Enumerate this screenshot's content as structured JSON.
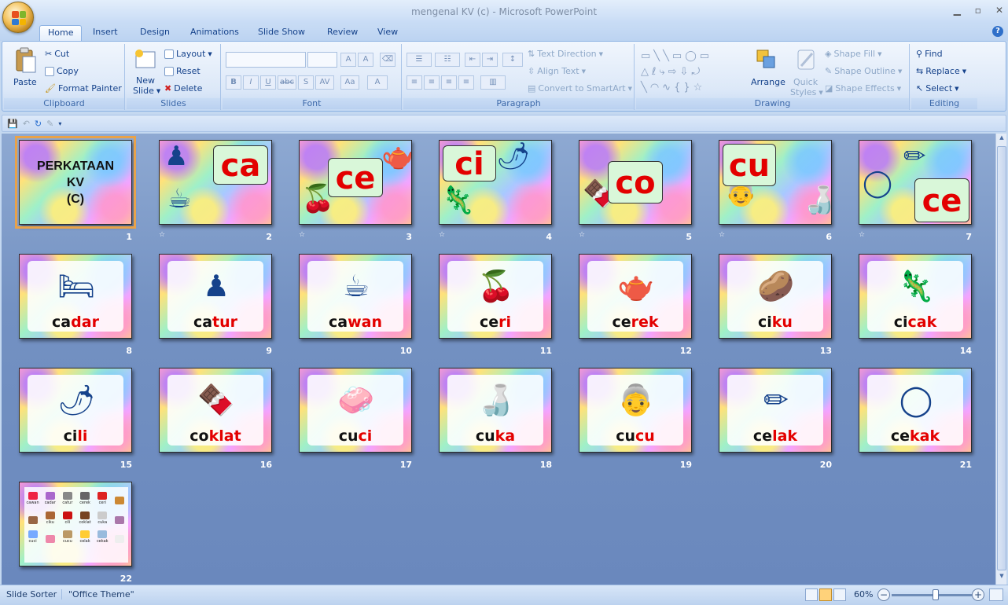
{
  "window": {
    "title": "mengenal KV (c)  -  Microsoft PowerPoint"
  },
  "ribbon_tabs": [
    "Home",
    "Insert",
    "Design",
    "Animations",
    "Slide Show",
    "Review",
    "View"
  ],
  "clipboard": {
    "paste": "Paste",
    "cut": "Cut",
    "copy": "Copy",
    "format_painter": "Format Painter",
    "label": "Clipboard"
  },
  "slides_group": {
    "new_slide": "New",
    "new_slide2": "Slide",
    "layout": "Layout",
    "reset": "Reset",
    "delete": "Delete",
    "label": "Slides"
  },
  "font_group": {
    "label": "Font",
    "bold": "B",
    "italic": "I",
    "underline": "U",
    "strike": "abc",
    "shadow": "S",
    "spacing": "AV",
    "case": "Aa",
    "color": "A"
  },
  "paragraph_group": {
    "label": "Paragraph",
    "text_direction": "Text Direction",
    "align_text": "Align Text",
    "convert_smartart": "Convert to SmartArt"
  },
  "drawing_group": {
    "label": "Drawing",
    "arrange": "Arrange",
    "quick_styles": "Quick",
    "quick_styles2": "Styles",
    "shape_fill": "Shape Fill",
    "shape_outline": "Shape Outline",
    "shape_effects": "Shape Effects"
  },
  "editing_group": {
    "label": "Editing",
    "find": "Find",
    "replace": "Replace",
    "select": "Select"
  },
  "title_slide": {
    "line1": "PERKATAAN",
    "line2": "KV",
    "line3": "(C)"
  },
  "syllable_slides": [
    {
      "num": "2",
      "syllable": "ca"
    },
    {
      "num": "3",
      "syllable": "ce"
    },
    {
      "num": "4",
      "syllable": "ci"
    },
    {
      "num": "5",
      "syllable": "co"
    },
    {
      "num": "6",
      "syllable": "cu"
    },
    {
      "num": "7",
      "syllable": "ce"
    }
  ],
  "word_slides": [
    {
      "num": "8",
      "a": "ca",
      "b": "dar",
      "icon": "bed-icon"
    },
    {
      "num": "9",
      "a": "ca",
      "b": "tur",
      "icon": "chessboard-icon"
    },
    {
      "num": "10",
      "a": "ca",
      "b": "wan",
      "icon": "cup-icon"
    },
    {
      "num": "11",
      "a": "ce",
      "b": "ri",
      "icon": "cherry-icon"
    },
    {
      "num": "12",
      "a": "ce",
      "b": "rek",
      "icon": "kettle-icon"
    },
    {
      "num": "13",
      "a": "ci",
      "b": "ku",
      "icon": "sapodilla-icon"
    },
    {
      "num": "14",
      "a": "ci",
      "b": "cak",
      "icon": "lizard-icon"
    },
    {
      "num": "15",
      "a": "ci",
      "b": "li",
      "icon": "chili-icon"
    },
    {
      "num": "16",
      "a": "co",
      "b": "klat",
      "icon": "chocolate-icon"
    },
    {
      "num": "17",
      "a": "cu",
      "b": "ci",
      "icon": "washing-icon"
    },
    {
      "num": "18",
      "a": "cu",
      "b": "ka",
      "icon": "vinegar-bottle-icon"
    },
    {
      "num": "19",
      "a": "cu",
      "b": "cu",
      "icon": "grandmother-icon"
    },
    {
      "num": "20",
      "a": "ce",
      "b": "lak",
      "icon": "pencil-icon"
    },
    {
      "num": "21",
      "a": "ce",
      "b": "kak",
      "icon": "ring-icon"
    }
  ],
  "title_slide_num": "1",
  "summary_slide": {
    "num": "22",
    "labels": [
      "cawan",
      "cadar",
      "catur",
      "cerek",
      "ceri",
      "",
      "",
      "ciku",
      "cili",
      "coklat",
      "cuka",
      "",
      "cuci",
      "",
      "cucu",
      "celak",
      "cekak",
      ""
    ]
  },
  "status": {
    "view": "Slide Sorter",
    "theme": "\"Office Theme\"",
    "zoom": "60%"
  },
  "colors": {
    "syllable_red": "#e30000",
    "selection": "#e8a24a",
    "sorter_bg": "#7391c2"
  }
}
